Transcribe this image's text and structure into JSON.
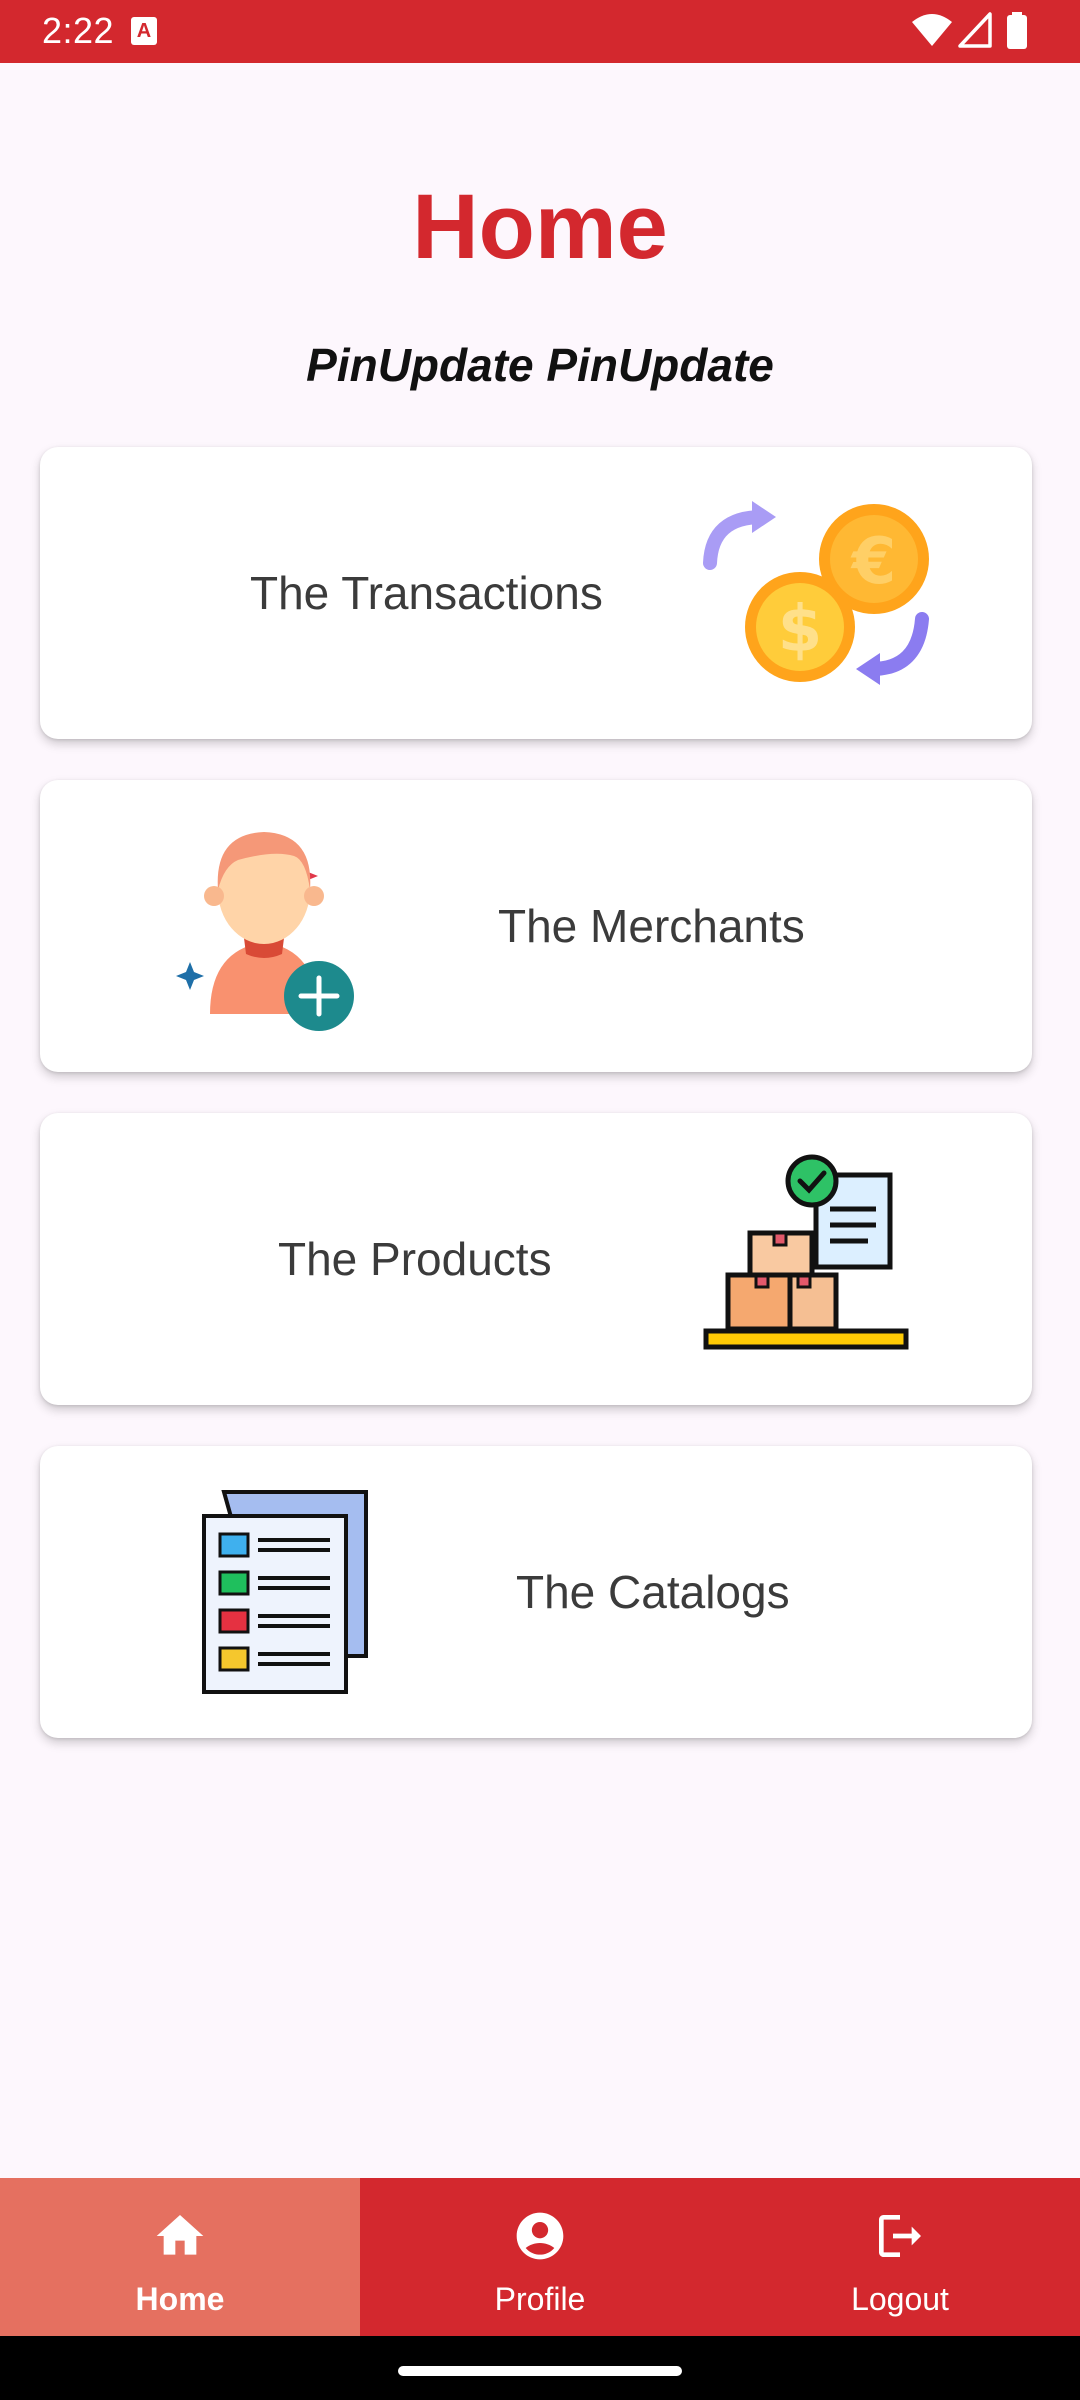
{
  "status": {
    "time": "2:22",
    "notification_glyph": "A"
  },
  "page": {
    "title": "Home",
    "subtitle": "PinUpdate PinUpdate"
  },
  "cards": [
    {
      "label": "The Transactions",
      "icon": "currency-exchange-icon"
    },
    {
      "label": "The Merchants",
      "icon": "add-user-icon"
    },
    {
      "label": "The Products",
      "icon": "inventory-boxes-icon"
    },
    {
      "label": "The Catalogs",
      "icon": "catalog-document-icon"
    }
  ],
  "nav": {
    "items": [
      {
        "label": "Home",
        "icon": "home-icon",
        "active": true
      },
      {
        "label": "Profile",
        "icon": "profile-icon",
        "active": false
      },
      {
        "label": "Logout",
        "icon": "logout-icon",
        "active": false
      }
    ]
  },
  "colors": {
    "primary": "#d3282e",
    "active_nav": "#e57060",
    "background": "#fdf7fd"
  }
}
